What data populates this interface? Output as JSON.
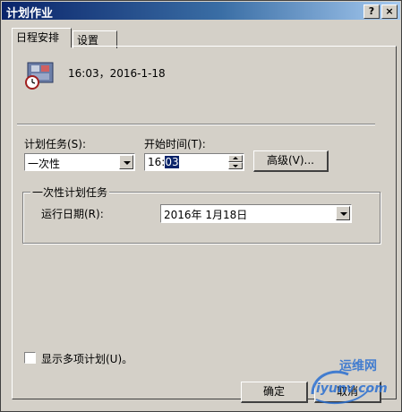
{
  "window": {
    "title": "计划作业",
    "help_btn": "?",
    "close_btn": "×"
  },
  "tabs": [
    {
      "label": "日程安排"
    },
    {
      "label": "设置"
    }
  ],
  "summary": {
    "text": "16:03，2016-1-18",
    "icon": "scheduled-task-icon"
  },
  "schedule": {
    "task_label": "计划任务(S):",
    "task_value": "一次性",
    "start_label": "开始时间(T):",
    "time_hour": "16:",
    "time_minute": "03",
    "advanced_btn": "高级(V)..."
  },
  "once_group": {
    "title": "一次性计划任务",
    "run_date_label": "运行日期(R):",
    "run_date_value": "2016年  1月18日"
  },
  "multiple": {
    "label": "显示多项计划(U)。",
    "checked": false
  },
  "footer": {
    "ok": "确定",
    "cancel": "取消"
  },
  "watermark": {
    "text": "运维网",
    "url_text": "iyunv.com"
  }
}
